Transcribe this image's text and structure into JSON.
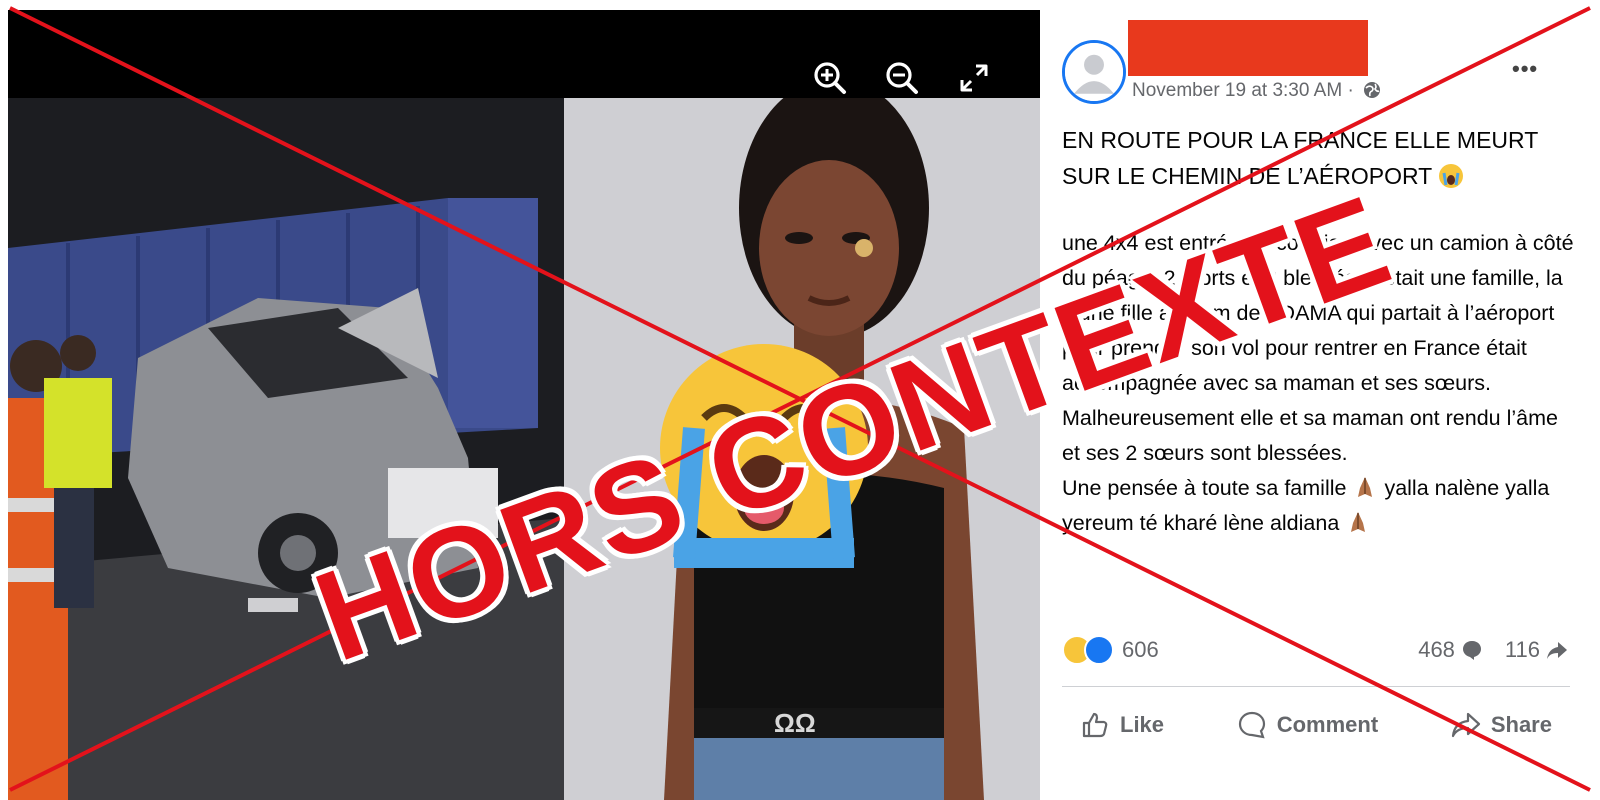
{
  "stamp": {
    "label": "HORS CONTEXTE",
    "color": "#e3121b"
  },
  "viewer": {
    "tools": [
      "zoom-in-icon",
      "zoom-out-icon",
      "fullscreen-icon"
    ]
  },
  "post": {
    "timestamp": "November 19 at 3:30 AM ·",
    "privacy_icon": "globe-icon",
    "more_label": "•••",
    "headline": "EN ROUTE POUR LA FRANCE ELLE MEURT SUR LE CHEMIN DE L’AÉROPORT",
    "body_lines": [
      "une 4x4 est entrée en collision avec un camion à côté du péage, 2 morts et 3 blessés, c’était une famille, la jeune fille au nom de ADAMA qui partait à l’aéroport pour prendre son vol pour rentrer en France était accompagnée avec sa maman et ses sœurs. Malheureusement elle et sa maman ont rendu l’âme et ses 2 sœurs sont blessées.",
      "Une pensée à toute sa famille",
      "yalla nalène yalla yereum té kharé lène aldiana"
    ],
    "reaction_count": "606",
    "comment_count": "468",
    "share_count": "116",
    "actions": {
      "like": "Like",
      "comment": "Comment",
      "share": "Share"
    },
    "colors": {
      "accent": "#1877f2",
      "redaction": "#e8391d",
      "muted": "#65676b"
    }
  }
}
